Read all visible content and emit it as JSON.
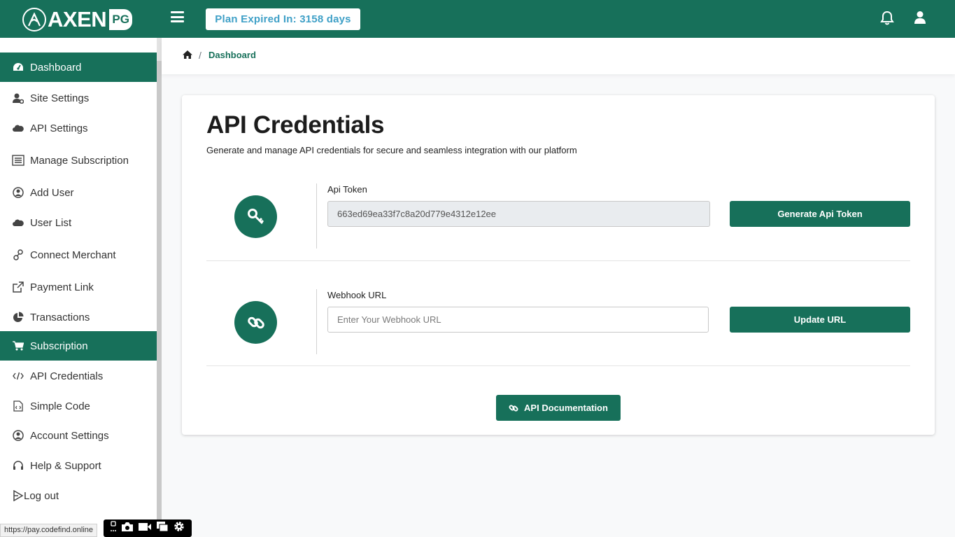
{
  "header": {
    "logo_text": "AXEN",
    "logo_badge": "PG",
    "plan_badge": "Plan Expired In: 3158 days"
  },
  "sidebar": {
    "items": [
      {
        "label": "Dashboard",
        "icon": "tachometer-icon",
        "active": true
      },
      {
        "label": "Site Settings",
        "icon": "user-cog-icon",
        "active": false
      },
      {
        "label": "API Settings",
        "icon": "cloud-icon",
        "active": false
      },
      {
        "label": "Manage Subscription",
        "icon": "list-icon",
        "active": false
      },
      {
        "label": "Add User",
        "icon": "user-circle-icon",
        "active": false
      },
      {
        "label": "User List",
        "icon": "cloud-icon",
        "active": false
      },
      {
        "label": "Connect Merchant",
        "icon": "link-icon",
        "active": false
      },
      {
        "label": "Payment Link",
        "icon": "external-link-icon",
        "active": false
      },
      {
        "label": "Transactions",
        "icon": "pie-chart-icon",
        "active": false
      },
      {
        "label": "Subscription",
        "icon": "cart-icon",
        "active": true
      },
      {
        "label": "API Credentials",
        "icon": "code-icon",
        "active": false
      },
      {
        "label": "Simple Code",
        "icon": "file-code-icon",
        "active": false
      },
      {
        "label": "Account Settings",
        "icon": "user-circle-icon",
        "active": false
      },
      {
        "label": "Help & Support",
        "icon": "headset-icon",
        "active": false
      },
      {
        "label": "Log out",
        "icon": "logout-icon",
        "active": false
      }
    ]
  },
  "breadcrumb": {
    "separator": "/",
    "current": "Dashboard"
  },
  "card": {
    "title": "API Credentials",
    "subtitle": "Generate and manage API credentials for secure and seamless integration with our platform",
    "api_token": {
      "label": "Api Token",
      "value": "663ed69ea33f7c8a20d779e4312e12ee",
      "button": "Generate Api Token"
    },
    "webhook": {
      "label": "Webhook URL",
      "placeholder": "Enter Your Webhook URL",
      "button": "Update URL"
    },
    "doc_button": "API Documentation"
  },
  "status_bar": {
    "url": "https://pay.codefind.online"
  },
  "colors": {
    "primary": "#17705a",
    "badge_text": "#3fa0c7"
  }
}
